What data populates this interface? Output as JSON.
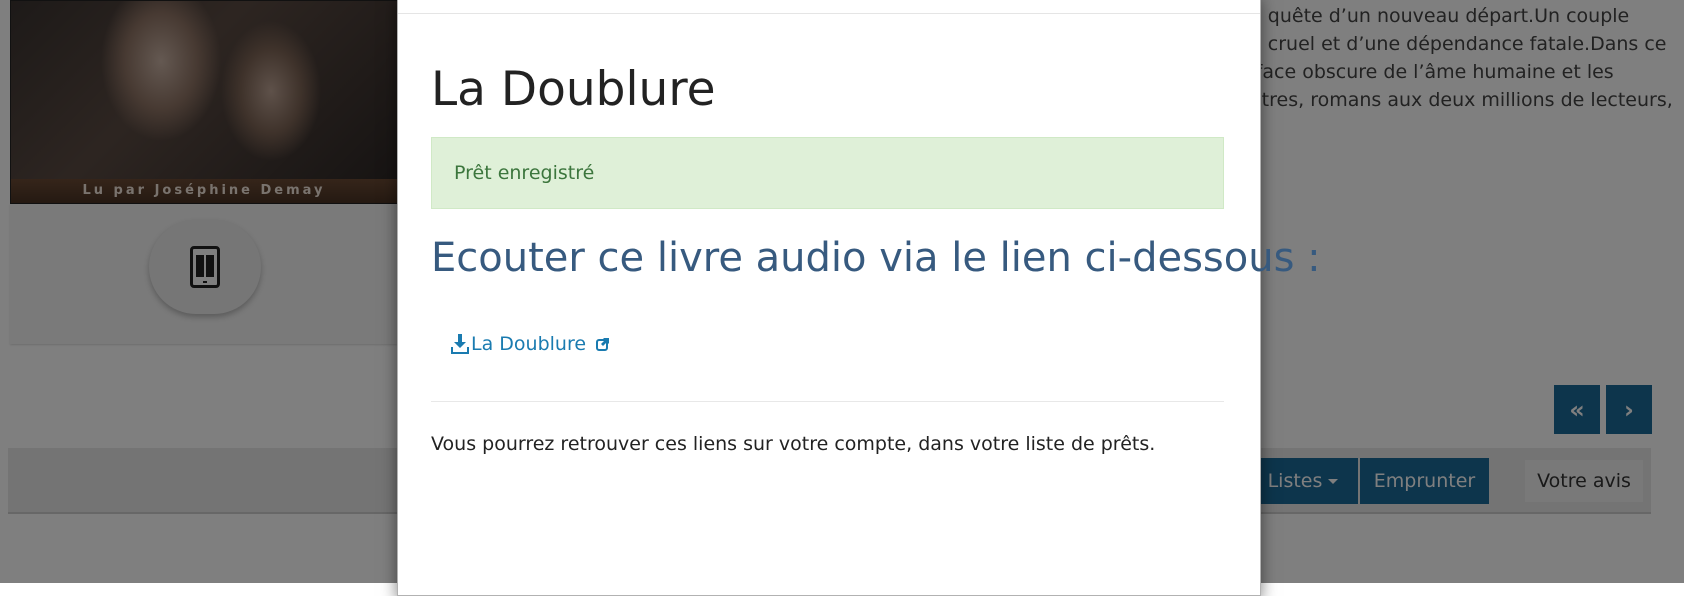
{
  "background": {
    "cover": {
      "caption": "Lu par Joséphine Demay"
    },
    "format_icon": "tablet-book-icon",
    "description_lines": [
      "en quête d’un nouveau départ.Un couple",
      "eu cruel et d’une dépendance fatale.Dans ce",
      "a face obscure de l’âme humaine et les",
      "autres, romans aux deux millions de lecteurs,"
    ],
    "pager": {
      "prev_icon": "«",
      "next_icon": "›"
    },
    "actions": {
      "listes_label": "Listes",
      "emprunter_label": "Emprunter",
      "avis_label": "Votre avis"
    }
  },
  "modal": {
    "title": "La Doublure",
    "alert": "Prêt enregistré",
    "subtitle": "Ecouter ce livre audio via le lien ci-dessous :",
    "link": {
      "label": "La Doublure",
      "icon": "download-icon",
      "ext_icon": "external-link-icon"
    },
    "note": "Vous pourrez retrouver ces liens sur votre compte, dans votre liste de prêts."
  },
  "colors": {
    "primary": "#1a6a99",
    "alert_bg": "#dff0d8",
    "alert_text": "#3c763d",
    "subtitle": "#375a7f",
    "link": "#1a7bb0"
  }
}
